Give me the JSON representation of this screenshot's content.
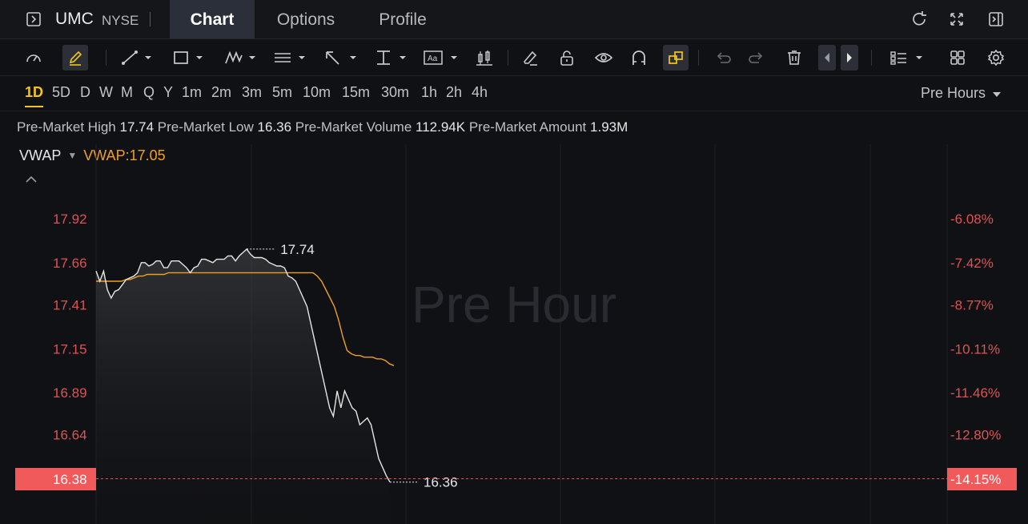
{
  "header": {
    "symbol": "UMC",
    "exchange": "NYSE",
    "tabs": [
      {
        "label": "Chart",
        "active": true
      },
      {
        "label": "Options",
        "active": false
      },
      {
        "label": "Profile",
        "active": false
      }
    ],
    "icons": [
      "sidebar-toggle-icon",
      "refresh-icon",
      "fullscreen-icon",
      "collapse-panel-icon"
    ]
  },
  "toolbar": {
    "tools": [
      "speedometer-icon",
      "pen-icon",
      "line-icon",
      "rectangle-icon",
      "pattern-icon",
      "fib-icon",
      "arrow-icon",
      "measure-icon",
      "text-icon",
      "candle-icon",
      "eraser-icon",
      "lock-icon",
      "eye-icon",
      "magnet-icon",
      "link-icon",
      "undo-icon",
      "redo-icon",
      "trash-icon",
      "prev-icon",
      "next-icon",
      "layout-icon",
      "grid-icon",
      "settings-icon"
    ]
  },
  "periods": {
    "items": [
      "1D",
      "5D",
      "D",
      "W",
      "M",
      "Q",
      "Y",
      "1m",
      "2m",
      "3m",
      "5m",
      "10m",
      "15m",
      "30m",
      "1h",
      "2h",
      "4h"
    ],
    "active": "1D",
    "session": "Pre Hours"
  },
  "premarket": {
    "high_label": "Pre-Market High",
    "high": "17.74",
    "low_label": "Pre-Market Low",
    "low": "16.36",
    "volume_label": "Pre-Market Volume",
    "volume": "112.94K",
    "amount_label": "Pre-Market Amount",
    "amount": "1.93M"
  },
  "indicator": {
    "name": "VWAP",
    "value_text": "VWAP:17.05"
  },
  "colors": {
    "price_line": "#e6e6e6",
    "vwap_line": "#f0a020",
    "down": "#e05252",
    "highlight": "#f5c518"
  },
  "chart_data": {
    "type": "line",
    "watermark": "Pre Hour",
    "y_ticks": [
      "17.92",
      "17.66",
      "17.41",
      "17.15",
      "16.89",
      "16.64"
    ],
    "y_right_ticks": [
      "-6.08%",
      "-7.42%",
      "-8.77%",
      "-10.11%",
      "-11.46%",
      "-12.80%"
    ],
    "current_price": "16.38",
    "current_pct": "-14.15%",
    "ylim": [
      16.38,
      17.92
    ],
    "high_label": "17.74",
    "low_label": "16.36",
    "series": [
      {
        "name": "Price",
        "x": [
          0,
          1,
          2,
          3,
          4,
          5,
          6,
          7,
          8,
          9,
          10,
          11,
          12,
          13,
          14,
          15,
          16,
          17,
          18,
          19,
          20,
          21,
          22,
          23,
          24,
          25,
          26,
          27,
          28,
          29,
          30,
          31,
          32,
          33,
          34,
          35,
          36,
          37,
          38,
          39,
          40,
          41,
          42,
          43,
          44,
          45,
          46,
          47,
          48,
          49,
          50,
          51,
          52,
          53,
          54,
          55,
          56,
          57,
          58,
          59,
          60,
          61,
          62,
          63,
          64,
          65,
          66,
          67,
          68,
          69,
          70,
          71,
          72,
          73,
          74,
          75,
          76,
          77,
          78,
          79,
          80,
          81,
          82,
          83,
          84,
          85,
          86,
          87,
          88,
          89,
          90,
          91,
          92,
          93,
          94,
          95,
          96,
          97,
          98,
          99,
          100
        ],
        "values": [
          17.61,
          17.55,
          17.61,
          17.5,
          17.45,
          17.49,
          17.5,
          17.53,
          17.56,
          17.57,
          17.58,
          17.6,
          17.66,
          17.66,
          17.64,
          17.65,
          17.67,
          17.67,
          17.63,
          17.63,
          17.67,
          17.67,
          17.67,
          17.65,
          17.63,
          17.6,
          17.63,
          17.64,
          17.68,
          17.68,
          17.67,
          17.66,
          17.68,
          17.68,
          17.68,
          17.7,
          17.7,
          17.67,
          17.7,
          17.72,
          17.74,
          17.71,
          17.69,
          17.69,
          17.69,
          17.68,
          17.66,
          17.65,
          17.64,
          17.64,
          17.63,
          17.58,
          17.57,
          17.55,
          17.5,
          17.45,
          17.4,
          17.3,
          17.2,
          17.1,
          17.0,
          16.9,
          16.8,
          16.75,
          16.9,
          16.8,
          16.9,
          16.85,
          16.8,
          16.78,
          16.7,
          16.72,
          16.74,
          16.7,
          16.6,
          16.5,
          16.45,
          16.4,
          16.36,
          16.36,
          16.36,
          16.36,
          16.36,
          16.36,
          16.36,
          16.36,
          16.36,
          16.36,
          16.36,
          16.36,
          16.36,
          16.36,
          16.36,
          16.36,
          16.36,
          16.36,
          16.36,
          16.36,
          16.36,
          16.36,
          16.36
        ]
      },
      {
        "name": "VWAP",
        "values": [
          17.55,
          17.55,
          17.55,
          17.55,
          17.55,
          17.55,
          17.55,
          17.56,
          17.56,
          17.57,
          17.58,
          17.58,
          17.59,
          17.59,
          17.59,
          17.59,
          17.59,
          17.6,
          17.6,
          17.6,
          17.6,
          17.6,
          17.6,
          17.6,
          17.6,
          17.6,
          17.6,
          17.6,
          17.6,
          17.6,
          17.6,
          17.6,
          17.6,
          17.6,
          17.6,
          17.6,
          17.6,
          17.6,
          17.6,
          17.6,
          17.6,
          17.6,
          17.6,
          17.6,
          17.6,
          17.6,
          17.6,
          17.6,
          17.6,
          17.6,
          17.6,
          17.6,
          17.58,
          17.55,
          17.5,
          17.45,
          17.4,
          17.32,
          17.22,
          17.14,
          17.12,
          17.11,
          17.11,
          17.1,
          17.1,
          17.1,
          17.09,
          17.09,
          17.08,
          17.06,
          17.05
        ]
      }
    ]
  }
}
